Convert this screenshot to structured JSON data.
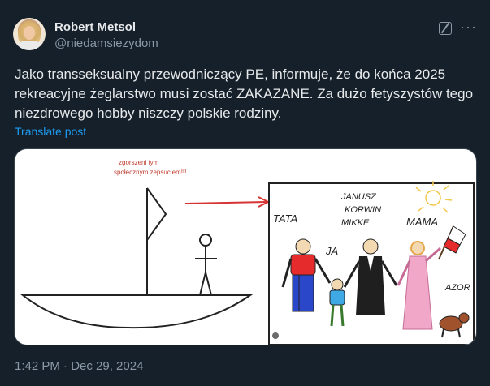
{
  "author": {
    "name": "Robert Metsol",
    "handle": "@niedamsiezydom"
  },
  "post": {
    "text": "Jako transseksualny przewodniczący PE, informuje, że do końca 2025 rekreacyjne żeglarstwo musi zostać ZAKAZANE. Za dużo fetyszystów tego niezdrowego hobby niszczy polskie rodziny.",
    "translate_label": "Translate post",
    "timestamp": "1:42 PM · Dec 29, 2024"
  },
  "media": {
    "caption_line1": "zgorszeni tym",
    "caption_line2": "społecznym zepsuciem!!!",
    "labels": {
      "tata": "TATA",
      "ja": "JA",
      "janusz1": "JANUSZ",
      "janusz2": "KORWIN",
      "janusz3": "MIKKE",
      "mama": "MAMA",
      "azor": "AZOR"
    },
    "colors": {
      "caption": "#c0392b",
      "shirt_red": "#e52b2b",
      "pants_blue": "#2a46c9",
      "dress_pink": "#f0a7c8",
      "sun": "#f5d76e"
    }
  },
  "icons": [
    "grok-icon",
    "more-icon"
  ]
}
